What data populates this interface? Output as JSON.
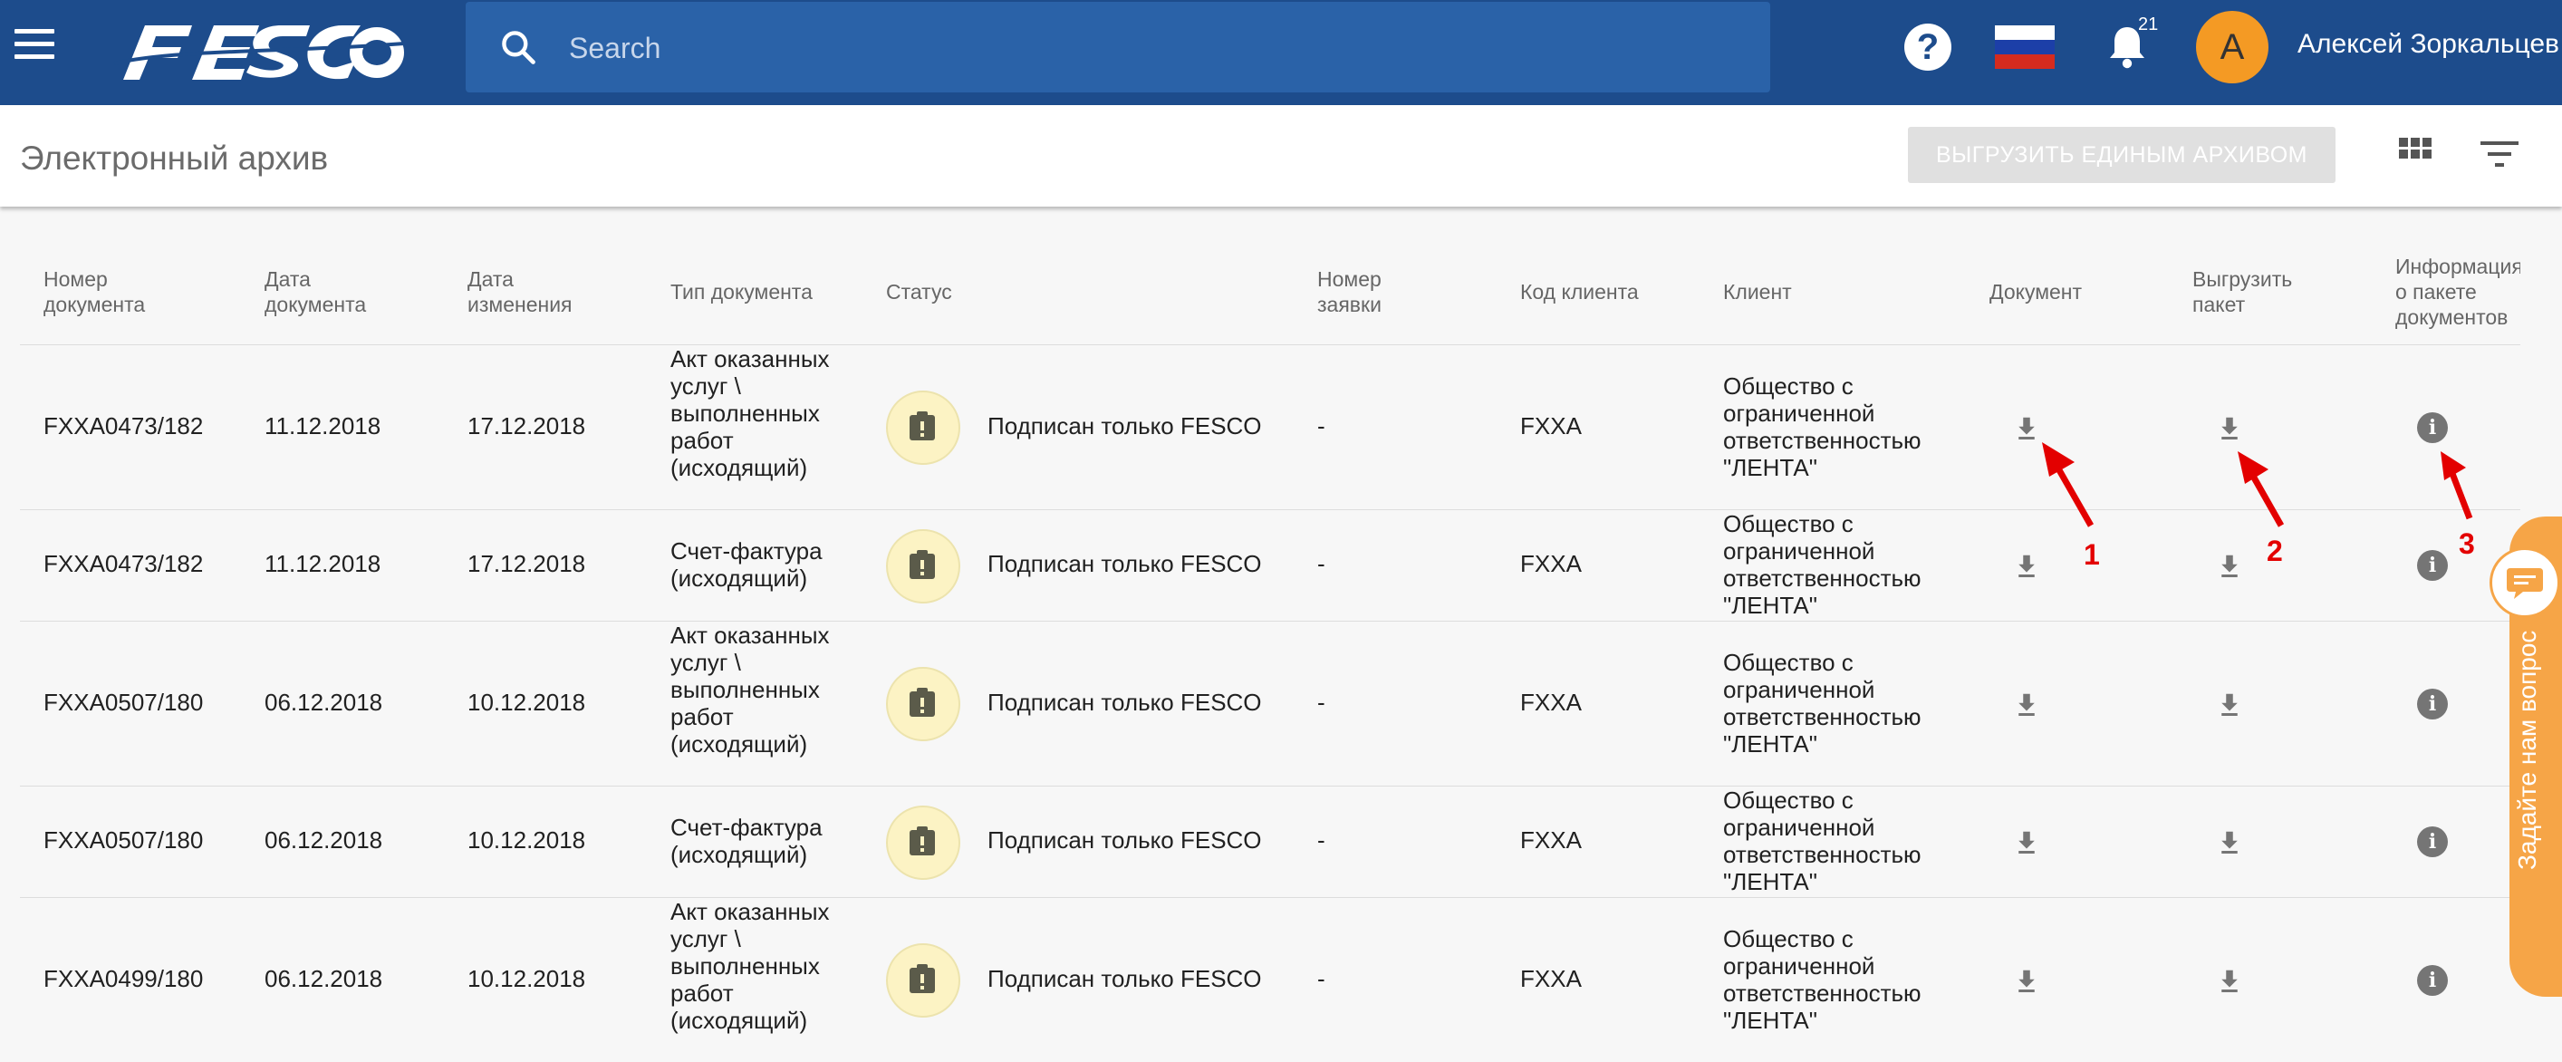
{
  "header": {
    "search_placeholder": "Search",
    "notifications_count": "21",
    "avatar_letter": "A",
    "user_name": "Алексей Зоркальцев",
    "help_glyph": "?"
  },
  "subheader": {
    "title": "Электронный архив",
    "export_label": "ВЫГРУЗИТЬ ЕДИНЫМ АРХИВОМ"
  },
  "table": {
    "columns": [
      "Номер документа",
      "Дата документа",
      "Дата изменения",
      "Тип документа",
      "Статус",
      "Номер заявки",
      "Код клиента",
      "Клиент",
      "Документ",
      "Выгрузить пакет",
      "Информация о пакете документов"
    ],
    "rows": [
      {
        "num": "FXXA0473/182",
        "date": "11.12.2018",
        "changed": "17.12.2018",
        "type": "Акт оказанных услуг \\ выполненных работ (исходящий)",
        "status": "Подписан только FESCO",
        "order": "-",
        "code": "FXXA",
        "client": "Общество с ограниченной ответственностью \"ЛЕНТА\""
      },
      {
        "num": "FXXA0473/182",
        "date": "11.12.2018",
        "changed": "17.12.2018",
        "type": "Счет-фактура (исходящий)",
        "status": "Подписан только FESCO",
        "order": "-",
        "code": "FXXA",
        "client": "Общество с ограниченной ответственностью \"ЛЕНТА\""
      },
      {
        "num": "FXXA0507/180",
        "date": "06.12.2018",
        "changed": "10.12.2018",
        "type": "Акт оказанных услуг \\ выполненных работ (исходящий)",
        "status": "Подписан только FESCO",
        "order": "-",
        "code": "FXXA",
        "client": "Общество с ограниченной ответственностью \"ЛЕНТА\""
      },
      {
        "num": "FXXA0507/180",
        "date": "06.12.2018",
        "changed": "10.12.2018",
        "type": "Счет-фактура (исходящий)",
        "status": "Подписан только FESCO",
        "order": "-",
        "code": "FXXA",
        "client": "Общество с ограниченной ответственностью \"ЛЕНТА\""
      },
      {
        "num": "FXXA0499/180",
        "date": "06.12.2018",
        "changed": "10.12.2018",
        "type": "Акт оказанных услуг \\ выполненных работ (исходящий)",
        "status": "Подписан только FESCO",
        "order": "-",
        "code": "FXXA",
        "client": "Общество с ограниченной ответственностью \"ЛЕНТА\""
      }
    ]
  },
  "annotations": [
    "1",
    "2",
    "3"
  ],
  "chat": {
    "label": "Задайте нам вопрос"
  },
  "colors": {
    "brand": "#1d4c8c",
    "accent": "#f49a24",
    "annotation": "#e30000"
  },
  "icons": [
    "menu-icon",
    "search-icon",
    "help-icon",
    "flag-russia-icon",
    "bell-icon",
    "grid-view-icon",
    "filter-icon",
    "status-warning-icon",
    "download-icon",
    "info-icon",
    "chat-icon"
  ]
}
